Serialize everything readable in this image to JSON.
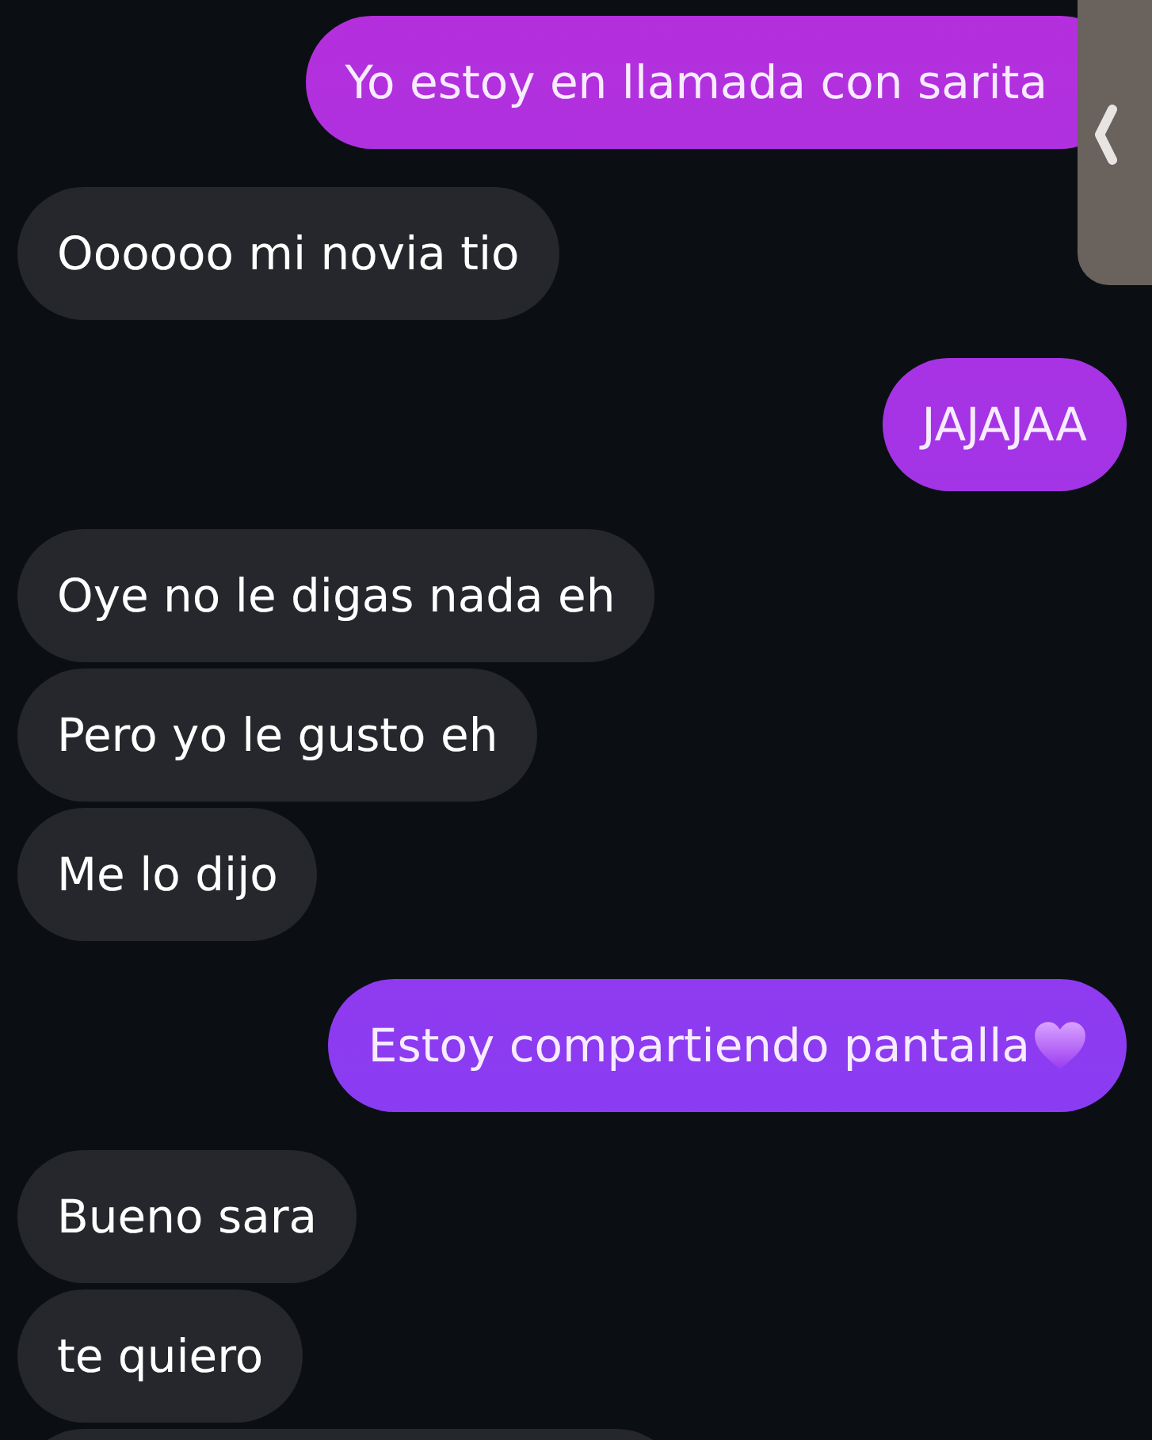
{
  "messages": [
    {
      "kind": "outgoing",
      "text": "Yo estoy en llamada con sarita"
    },
    {
      "kind": "incoming",
      "text": "Oooooo mi novia tio"
    },
    {
      "kind": "outgoing",
      "text": "JAJAJAA"
    },
    {
      "kind": "incoming",
      "text": "Oye no le digas nada eh"
    },
    {
      "kind": "incoming",
      "text": "Pero yo le gusto eh"
    },
    {
      "kind": "incoming",
      "text": "Me lo dijo"
    },
    {
      "kind": "outgoing",
      "text": "Estoy compartiendo pantalla",
      "heart": true
    },
    {
      "kind": "incoming",
      "text": "Bueno sara"
    },
    {
      "kind": "incoming",
      "text": "te quiero"
    }
  ]
}
